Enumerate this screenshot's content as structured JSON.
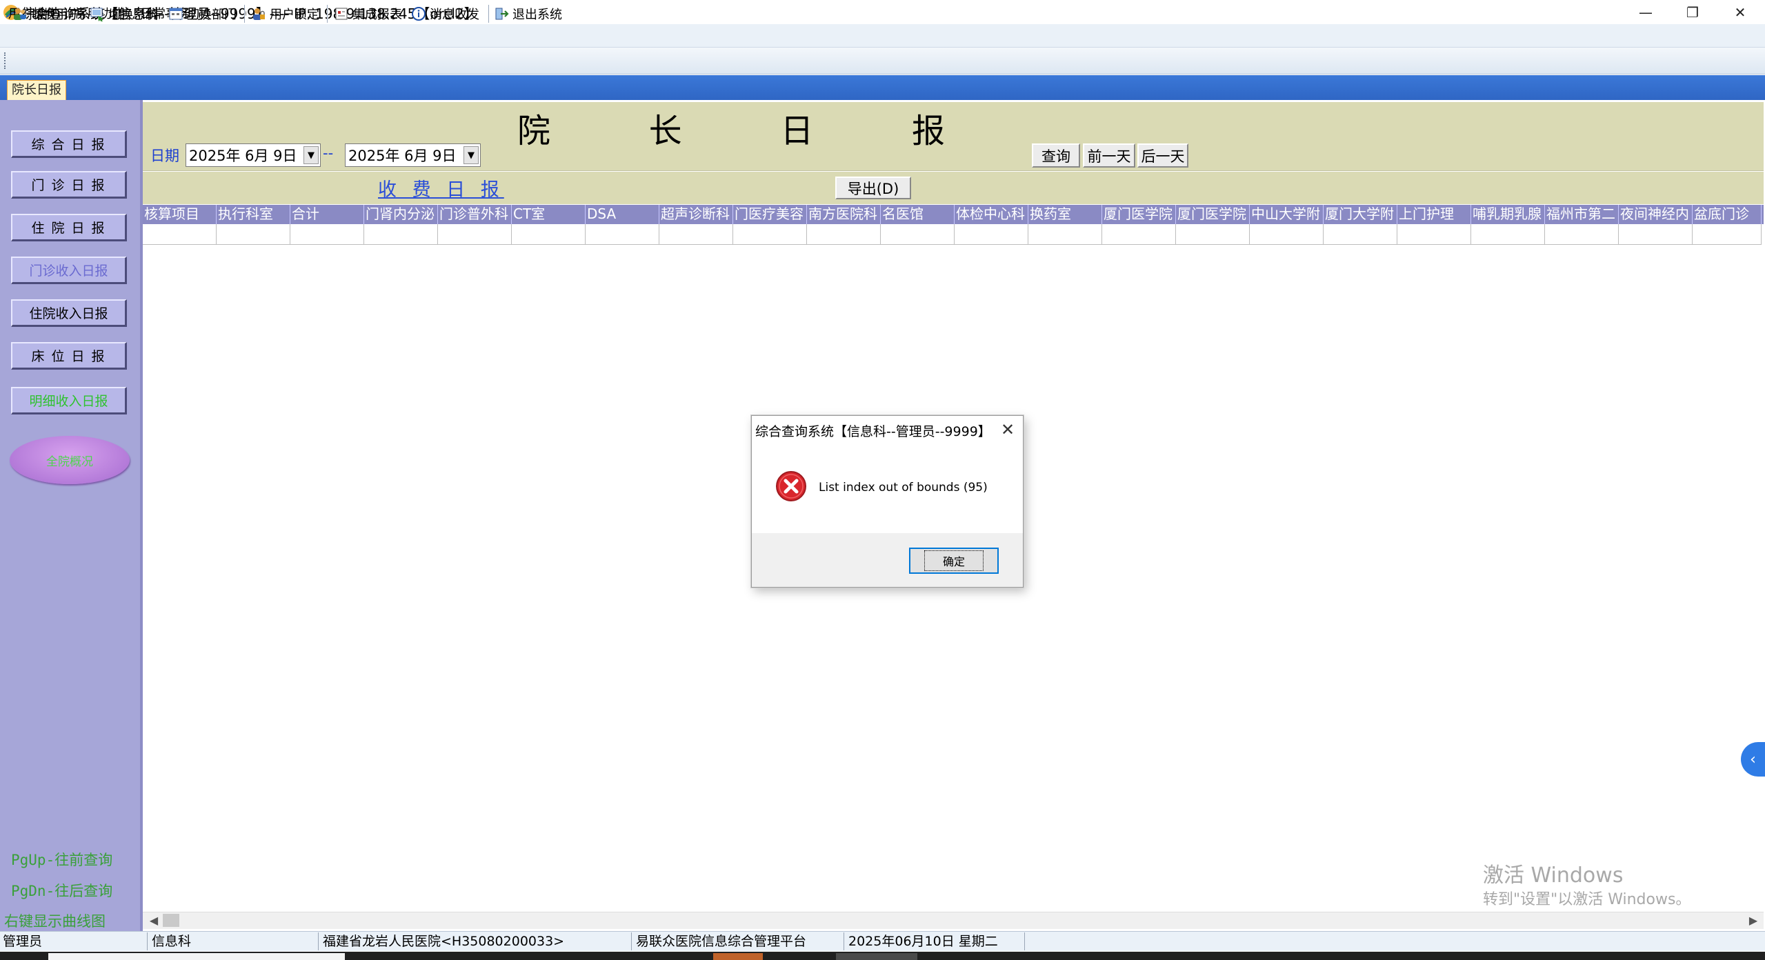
{
  "window": {
    "title": "综合查询系统【信息科--管理员--9999】---- IP:  198.9.138.245【orcl2】",
    "minimize": "—",
    "restore": "❐",
    "close": "✕"
  },
  "menu": [
    "用户操作",
    "常用功能",
    "日常事务"
  ],
  "toolbar": [
    "切换用户",
    "切换系统",
    "切换部门",
    "用户锁定",
    "集成报表",
    "消息收发",
    "退出系统"
  ],
  "tab": {
    "label": "院长日报"
  },
  "sidebar": {
    "buttons": [
      "综 合 日 报",
      "门 诊 日 报",
      "住 院 日 报",
      "门诊收入日报",
      "住院收入日报",
      "床 位 日 报",
      "明细收入日报"
    ],
    "oval": "全院概况",
    "hints": [
      "PgUp-往前查询",
      "PgDn-往后查询",
      "右键显示曲线图"
    ]
  },
  "header": {
    "title_chars": [
      "院",
      "长",
      "日",
      "报"
    ],
    "date_label": "日期",
    "date_from": "2025年 6月 9日",
    "date_sep": "--",
    "date_to": "2025年 6月 9日",
    "query_btn": "查询",
    "prev_btn": "前一天",
    "next_btn": "后一天"
  },
  "subheader": {
    "charge_title": "收 费 日 报",
    "export_btn": "导出(D)"
  },
  "grid": {
    "columns": [
      "核算项目",
      "执行科室",
      "合计",
      "门肾内分泌",
      "门诊普外科",
      "CT室",
      "DSA",
      "超声诊断科",
      "门医疗美容",
      "南方医院科",
      "名医馆",
      "体检中心科",
      "换药室",
      "厦门医学院",
      "厦门医学院",
      "中山大学附",
      "厦门大学附",
      "上门护理",
      "哺乳期乳腺",
      "福州市第二",
      "夜间神经内",
      "盆底门诊"
    ]
  },
  "watermark": {
    "line1": "激活 Windows",
    "line2": "转到\"设置\"以激活 Windows。"
  },
  "side_tab": {
    "glyph": "‹"
  },
  "status": [
    "管理员",
    "信息科",
    "福建省龙岩人民医院<H35080200033>",
    "易联众医院信息综合管理平台",
    "2025年06月10日 星期二",
    ""
  ],
  "dialog": {
    "title": "综合查询系统【信息科--管理员--9999】",
    "close": "✕",
    "message": "List index out of bounds (95)",
    "ok": "确定"
  },
  "colors": {
    "sidebar": "#a6a6d8",
    "header_panel": "#dadab4",
    "grid_header": "#8a8ac4",
    "accent_blue": "#2a4ed8",
    "error_red": "#d9262c"
  }
}
